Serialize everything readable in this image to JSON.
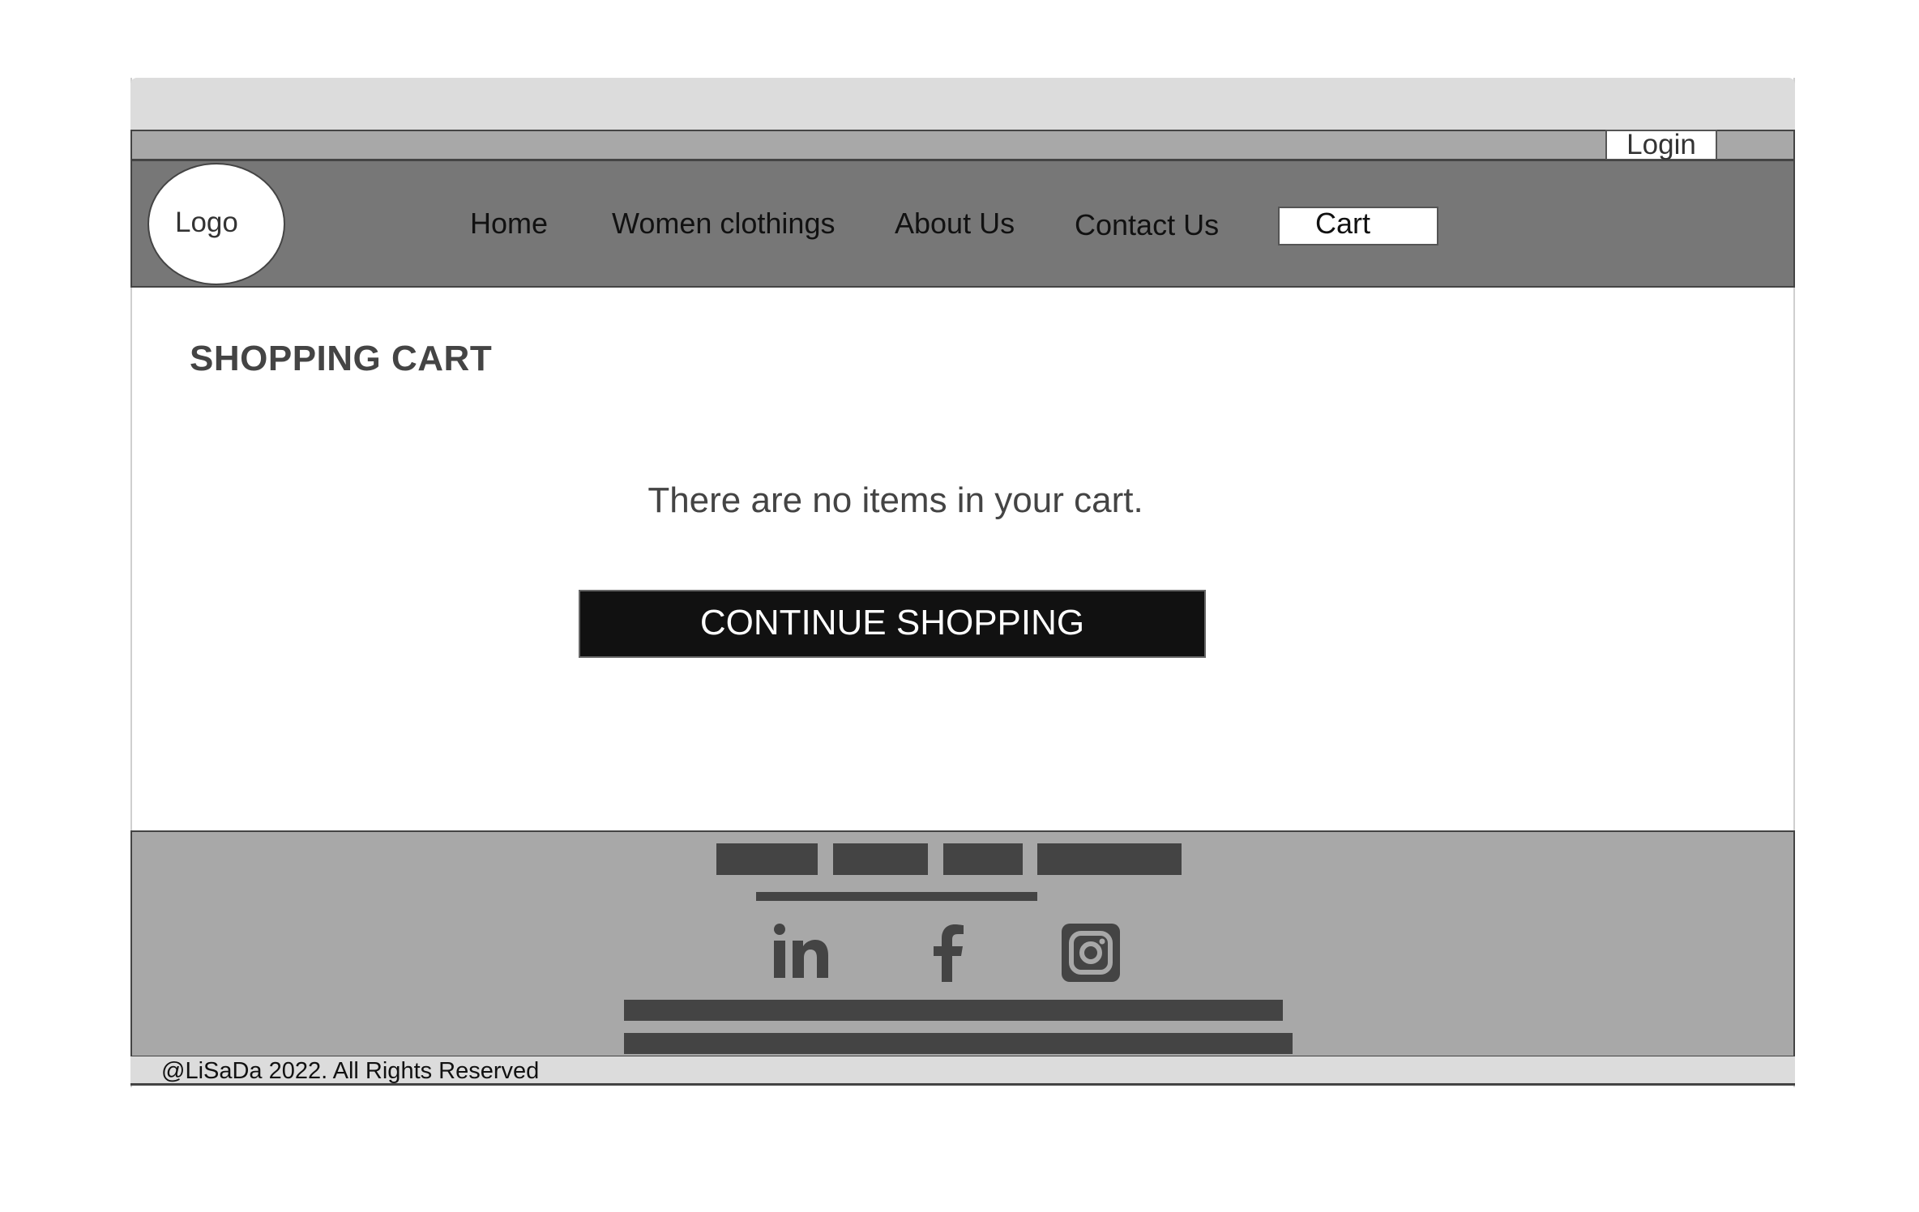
{
  "header": {
    "login_label": "Login",
    "logo_label": "Logo"
  },
  "nav": {
    "items": [
      {
        "label": "Home"
      },
      {
        "label": "Women clothings"
      },
      {
        "label": "About Us"
      },
      {
        "label": "Contact Us"
      }
    ],
    "cart_label": "Cart"
  },
  "main": {
    "title": "SHOPPING CART",
    "empty_message": "There are no items in your cart.",
    "continue_label": "CONTINUE SHOPPING"
  },
  "footer": {
    "social": [
      "linkedin-icon",
      "facebook-icon",
      "instagram-icon"
    ],
    "copyright": "@LiSaDa 2022. All Rights Reserved"
  },
  "colors": {
    "nav_bg": "#777777",
    "topbar_bg": "#a8a8a8",
    "footer_bg": "#a8a8a8",
    "button_bg": "#111111",
    "placeholder": "#444444"
  }
}
